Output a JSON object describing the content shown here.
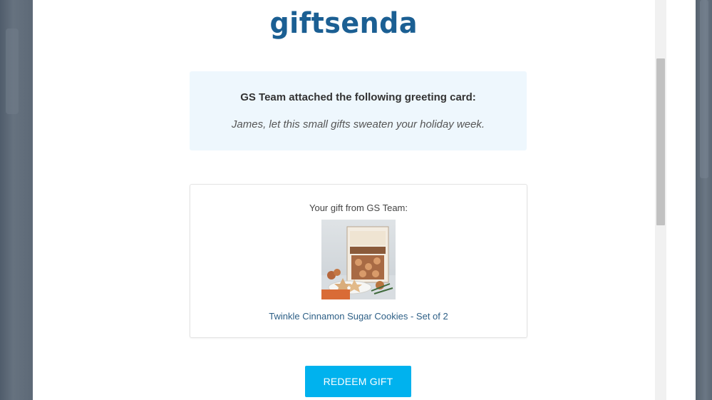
{
  "brand": {
    "logo_text": "giftsenda",
    "color": "#1b5f93"
  },
  "greeting_card": {
    "title": "GS Team attached the following greeting card:",
    "message": "James, let this small gifts sweaten your holiday week."
  },
  "gift": {
    "heading": "Your gift from GS Team:",
    "product_name": "Twinkle Cinnamon Sugar Cookies - Set of 2",
    "image_alt_icon": "cookie-box-photo"
  },
  "actions": {
    "redeem_label": "REDEEM GIFT",
    "redeem_color": "#00b2ee"
  }
}
